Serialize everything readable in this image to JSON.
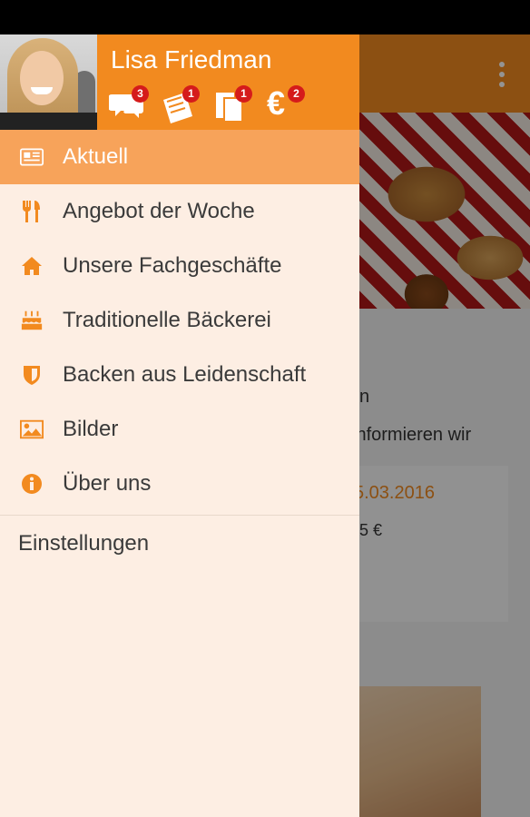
{
  "colors": {
    "accent": "#f28a1f",
    "active_row": "#f7a35a",
    "drawer_bg": "#fdeee3",
    "badge": "#d51b1b",
    "text": "#3a3a3a"
  },
  "background": {
    "intro_text_1": "n",
    "intro_text_2": "informieren wir",
    "offer_date": "5.03.2016",
    "offer_price": "5 €"
  },
  "user": {
    "name": "Lisa Friedman"
  },
  "stats": [
    {
      "icon": "chat-icon",
      "count": "3"
    },
    {
      "icon": "coupon-icon",
      "count": "1"
    },
    {
      "icon": "cards-icon",
      "count": "1"
    },
    {
      "icon": "euro-icon",
      "symbol": "€",
      "count": "2"
    }
  ],
  "menu": {
    "items": [
      {
        "label": "Aktuell",
        "icon": "news-icon",
        "active": true
      },
      {
        "label": "Angebot der Woche",
        "icon": "cutlery-icon",
        "active": false
      },
      {
        "label": "Unsere Fachgeschäfte",
        "icon": "home-icon",
        "active": false
      },
      {
        "label": "Traditionelle Bäckerei",
        "icon": "cake-icon",
        "active": false
      },
      {
        "label": "Backen aus Leidenschaft",
        "icon": "shield-icon",
        "active": false
      },
      {
        "label": "Bilder",
        "icon": "image-icon",
        "active": false
      },
      {
        "label": "Über uns",
        "icon": "info-icon",
        "active": false
      }
    ],
    "settings_label": "Einstellungen"
  }
}
